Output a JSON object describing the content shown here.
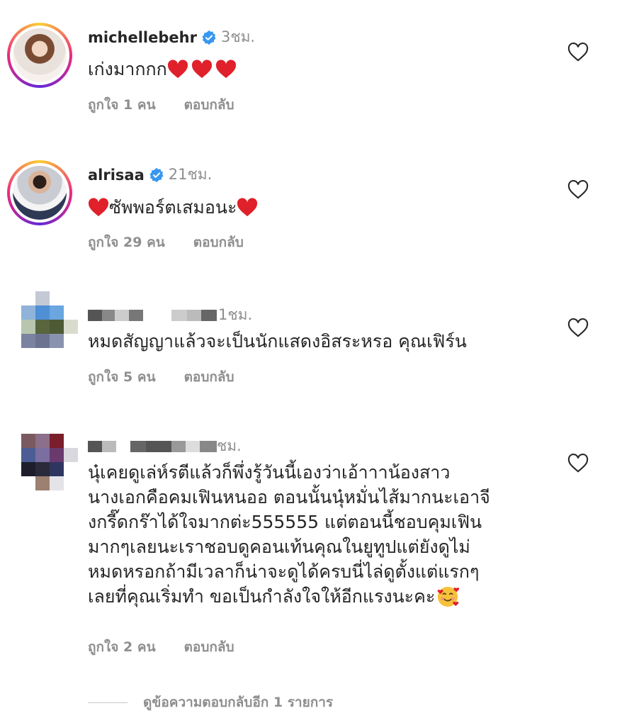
{
  "comments": [
    {
      "username": "michellebehr",
      "verified": true,
      "time": "3ชม.",
      "text": "เก่งมากกก",
      "likes": "ถูกใจ 1 คน",
      "reply": "ตอบกลับ"
    },
    {
      "username": "alrisaa",
      "verified": true,
      "time": "21ชม.",
      "text": "ซัพพอร์ตเสมอนะ",
      "likes": "ถูกใจ 29 คน",
      "reply": "ตอบกลับ"
    },
    {
      "username": "",
      "verified": false,
      "time": "1ชม.",
      "text": "หมดสัญญาแล้วจะเป็นนักแสดงอิสระหรอ คุณเฟิร์น",
      "likes": "ถูกใจ 5 คน",
      "reply": "ตอบกลับ"
    },
    {
      "username": "",
      "verified": false,
      "time": "ชม.",
      "lines": [
        "นุ๋เคยดูเล่ห์รตีแล้วก็พึ่งรู้วันนี้เองว่าเอ้าาาน้องสาว",
        "นางเอกคือคมเฟินหนออ ตอนนั้นนุ๋หมั่นไส้มากนะเอาจี",
        "งกรี๊ดกร๊าได้ใจมากต่ะ555555 แต่ตอนนี้ชอบคุมเฟิน",
        "มากๆเลยนะเราชอบดูคอนเท้นคุณในยูทูปแต่ยังดูไม่",
        "หมดหรอกถ้ามีเวลาก็น่าจะดูได้ครบนี่ไล่ดูตั้งแต่แรกๆ",
        "เลยที่คุณเริ่มทำ ขอเป็นกำลังใจให้อีกแรงนะคะ"
      ],
      "likes": "ถูกใจ 2 คน",
      "reply": "ตอบกลับ"
    }
  ],
  "view_more": "ดูข้อความตอบกลับอีก 1 รายการ",
  "colors": {
    "verified": "#3897f0",
    "heart_emoji": "#e0202a",
    "muted": "#8e8e8e"
  },
  "icons": [
    "heart-outline-icon",
    "verified-badge-icon",
    "red-heart-emoji",
    "smiling-face-with-hearts-emoji"
  ]
}
